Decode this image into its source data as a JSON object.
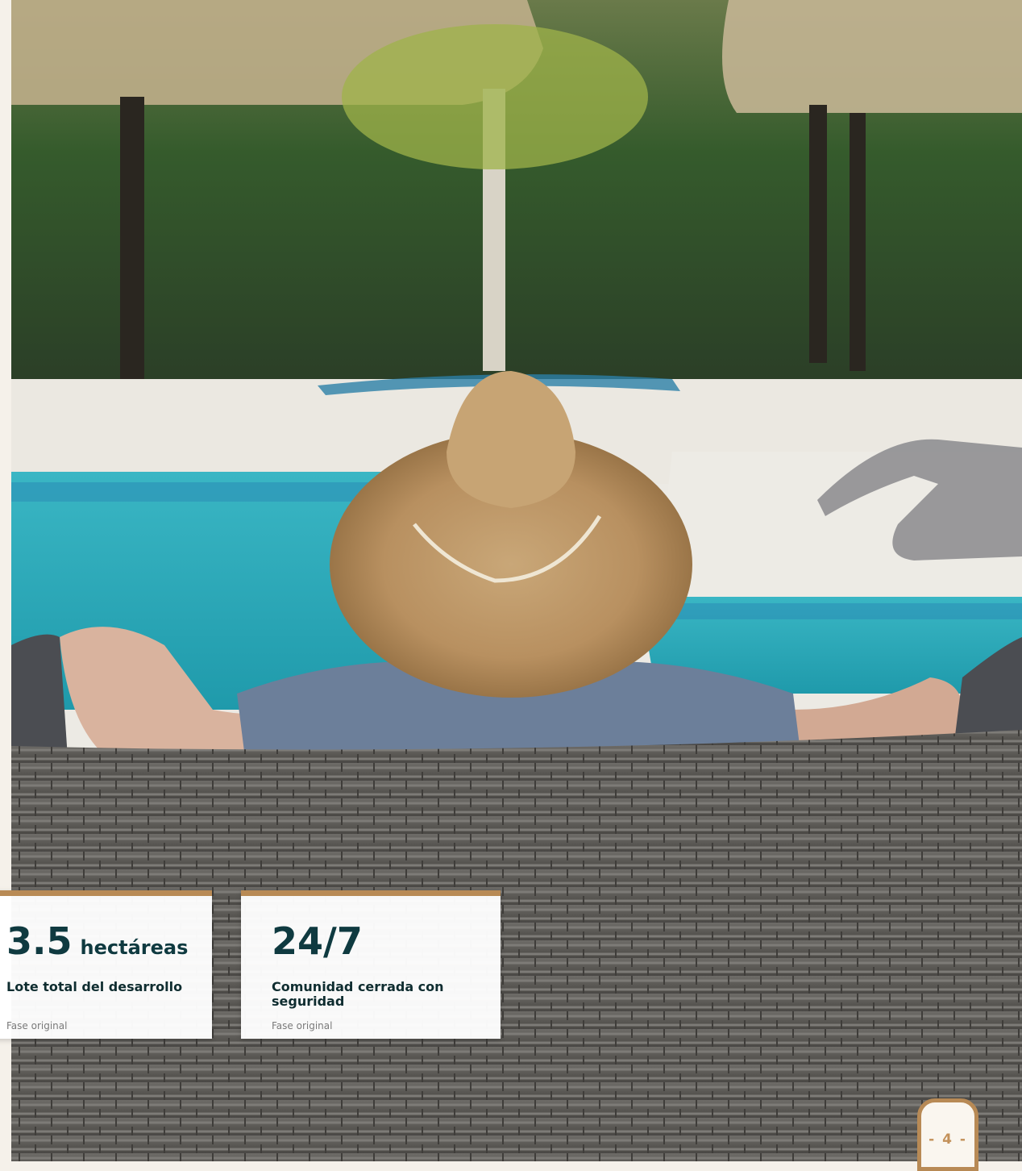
{
  "page": {
    "number_label": "- 4 -"
  },
  "stats": [
    {
      "value": "3.5",
      "unit": "hectáreas",
      "description": "Lote total del desarrollo",
      "note": "Fase original"
    },
    {
      "value": "24/7",
      "unit": "",
      "description": "Comunidad cerrada con seguridad",
      "note": "Fase original"
    }
  ],
  "colors": {
    "accent": "#b88a55",
    "heading": "#0f3a40",
    "background": "#f5f1ea"
  },
  "photo": {
    "subject": "person-in-straw-hat-relaxing-by-pool"
  }
}
